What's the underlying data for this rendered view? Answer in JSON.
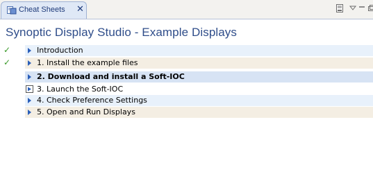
{
  "tab": {
    "label": "Cheat Sheets",
    "close": "✕"
  },
  "title": "Synoptic Display Studio - Example Displays",
  "items": [
    {
      "label": "Introduction",
      "completed": true,
      "current": false
    },
    {
      "label": "1. Install the example files",
      "completed": true,
      "current": false
    },
    {
      "label": "2. Download and install a Soft-IOC",
      "completed": false,
      "current": true
    },
    {
      "label": "3. Launch the Soft-IOC",
      "completed": false,
      "current": false
    },
    {
      "label": "4. Check Preference Settings",
      "completed": false,
      "current": false
    },
    {
      "label": "5. Open and Run Displays",
      "completed": false,
      "current": false
    }
  ],
  "colors": {
    "row_odd": "#e8f1fb",
    "row_even": "#f4eee3",
    "row_current": "#d7e3f4",
    "check": "#3a9a2a",
    "arrow": "#2b5fb9",
    "title": "#2f4d8a"
  },
  "icons": {
    "tab_icon": "cheatsheet-icon",
    "check": "checkmark-icon",
    "expand": "expand-arrow-icon",
    "step": "step-launch-icon",
    "minimize": "minimize-icon",
    "maximize": "maximize-icon",
    "menu": "view-menu-icon",
    "toolbar": "view-toolbar-icon"
  }
}
